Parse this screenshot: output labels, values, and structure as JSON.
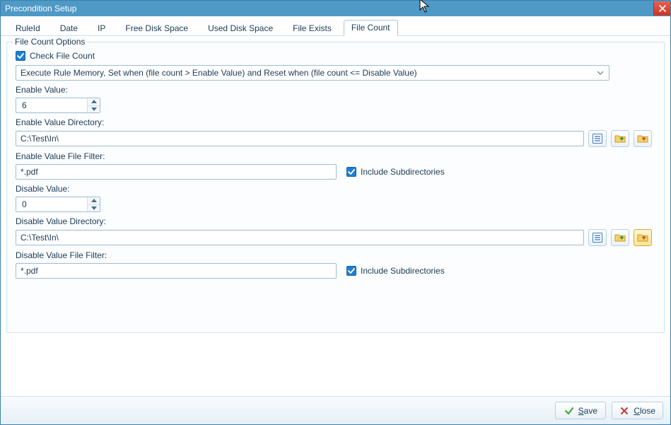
{
  "window": {
    "title": "Precondition Setup"
  },
  "tabs": [
    {
      "label": "RuleId"
    },
    {
      "label": "Date"
    },
    {
      "label": "IP"
    },
    {
      "label": "Free Disk Space"
    },
    {
      "label": "Used Disk Space"
    },
    {
      "label": "File Exists"
    },
    {
      "label": "File Count"
    }
  ],
  "activeTabIndex": 6,
  "group": {
    "title": "File Count Options",
    "check_label": "Check File Count",
    "check_checked": true,
    "condition_selected": "Execute Rule Memory, Set when (file count > Enable Value) and Reset when (file count <= Disable Value)",
    "enable_value_label": "Enable Value:",
    "enable_value": "6",
    "enable_dir_label": "Enable Value Directory:",
    "enable_dir": "C:\\Test\\In\\",
    "enable_filter_label": "Enable Value File Filter:",
    "enable_filter": "*.pdf",
    "enable_include_sub_label": "Include Subdirectories",
    "enable_include_sub_checked": true,
    "disable_value_label": "Disable Value:",
    "disable_value": "0",
    "disable_dir_label": "Disable Value Directory:",
    "disable_dir": "C:\\Test\\In\\",
    "disable_filter_label": "Disable Value File Filter:",
    "disable_filter": "*.pdf",
    "disable_include_sub_label": "Include Subdirectories",
    "disable_include_sub_checked": true
  },
  "footer": {
    "save_label": "Save",
    "close_label": "Close"
  }
}
